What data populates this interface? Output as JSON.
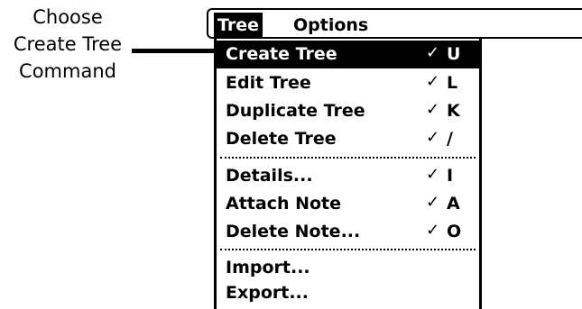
{
  "callout": {
    "lines": [
      "Choose",
      "Create Tree",
      "Command"
    ]
  },
  "menubar": {
    "titles": [
      "Tree",
      "Options"
    ]
  },
  "menu": {
    "shortcut_glyph": "✓",
    "items": [
      {
        "label": "Create Tree",
        "key": "U",
        "selected": true
      },
      {
        "label": "Edit Tree",
        "key": "L"
      },
      {
        "label": "Duplicate Tree",
        "key": "K"
      },
      {
        "label": "Delete Tree",
        "key": "/"
      },
      {
        "label": "Details...",
        "key": "I"
      },
      {
        "label": "Attach Note",
        "key": "A"
      },
      {
        "label": "Delete Note...",
        "key": "O"
      },
      {
        "label": "Import..."
      },
      {
        "label": "Export..."
      }
    ]
  }
}
